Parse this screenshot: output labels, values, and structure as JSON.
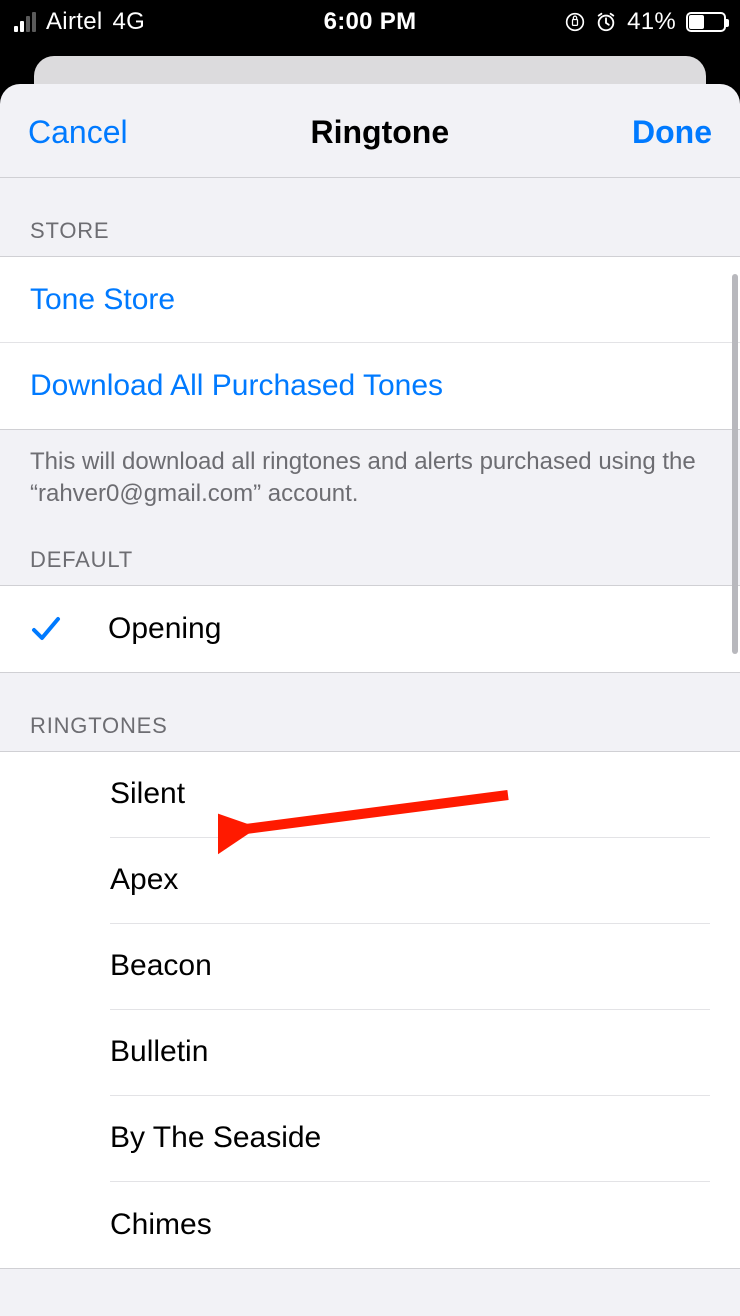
{
  "status": {
    "carrier": "Airtel",
    "network": "4G",
    "time": "6:00 PM",
    "battery_pct": "41%"
  },
  "nav": {
    "cancel": "Cancel",
    "title": "Ringtone",
    "done": "Done"
  },
  "sections": {
    "store_header": "STORE",
    "store_items": {
      "tone_store": "Tone Store",
      "download_all": "Download All Purchased Tones"
    },
    "store_footer": "This will download all ringtones and alerts purchased using the “rahver0@gmail.com” account.",
    "default_header": "DEFAULT",
    "default_item": "Opening",
    "ringtones_header": "RINGTONES",
    "ringtones": [
      "Silent",
      "Apex",
      "Beacon",
      "Bulletin",
      "By The Seaside",
      "Chimes"
    ]
  }
}
